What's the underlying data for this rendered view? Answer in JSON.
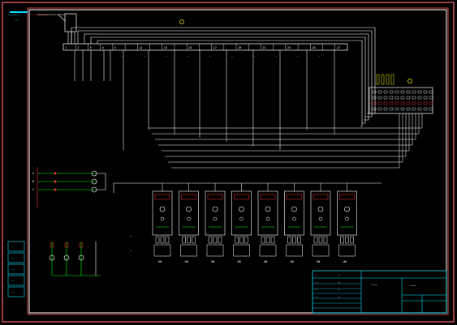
{
  "colors": {
    "background": "#000000",
    "outer_frame": "#ff6b6b",
    "inner_frame": "#ffffff",
    "wire": "#ffffff",
    "accent_green": "#00ff00",
    "accent_red": "#ff3030",
    "accent_cyan": "#00e5ff",
    "accent_yellow": "#ffff00",
    "accent_magenta": "#ff40ff"
  },
  "header": {
    "top_left_label": "——————",
    "top_left_sublabel": "——",
    "source_label": "————————"
  },
  "terminal_strip": {
    "labels": [
      "1",
      "2",
      "3",
      "4",
      "5",
      "",
      "11",
      "",
      "13",
      "",
      "15",
      "",
      "17",
      "",
      "19",
      "",
      "21",
      "",
      "23",
      "",
      "25",
      "",
      "27"
    ]
  },
  "units": {
    "count": 8,
    "bottom_labels": [
      "UW",
      "UW",
      "UW",
      "UW",
      "UW",
      "UW",
      "UW",
      "UW"
    ]
  },
  "left_block": {
    "side_labels": [
      "A",
      "B",
      "C"
    ]
  },
  "left_stack": {
    "labels": [
      "——",
      "——",
      "——",
      "——",
      "——"
    ]
  },
  "title_block": {
    "title": "———",
    "subtitle": "———",
    "small_labels": [
      "——",
      "——",
      "——",
      "——",
      "——",
      "——",
      "——",
      "——"
    ]
  },
  "icons": [
    "circle-marker-icon",
    "terminal-icon",
    "breaker-icon",
    "coil-icon"
  ]
}
